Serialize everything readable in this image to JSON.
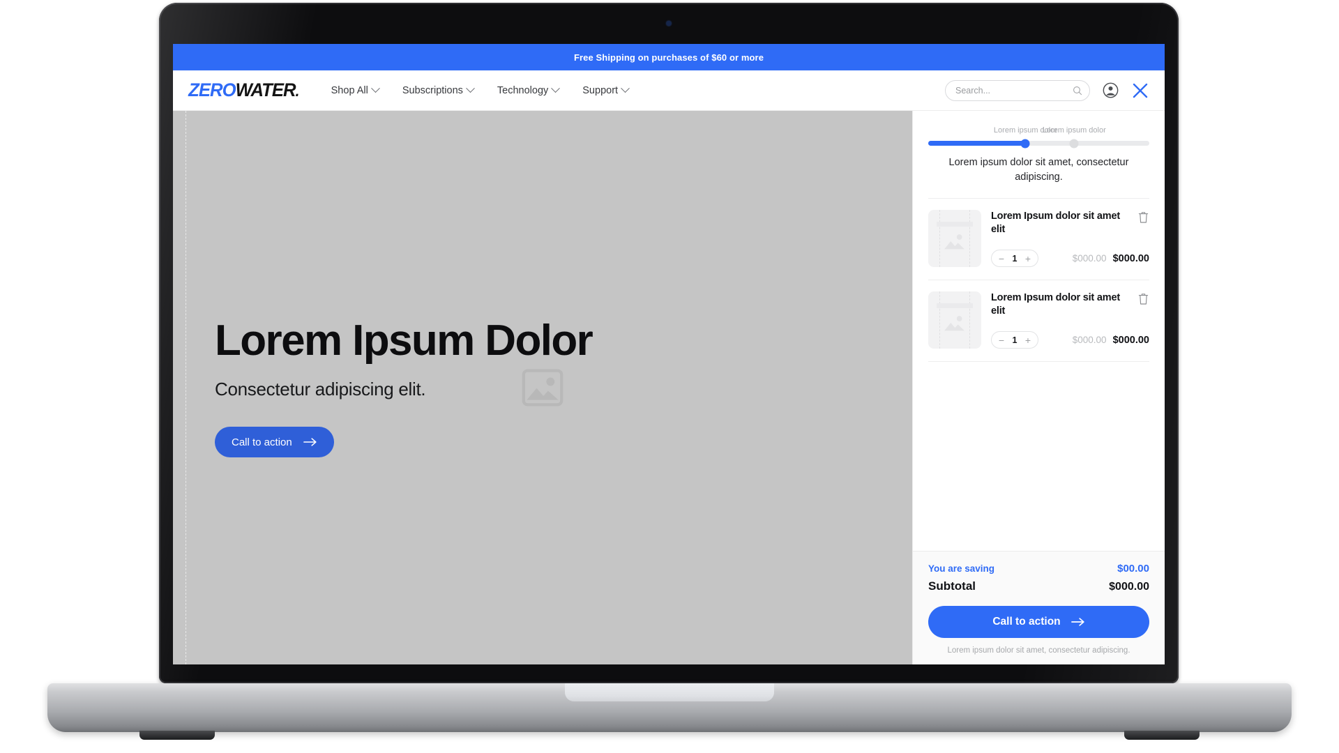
{
  "promo": {
    "text": "Free Shipping on purchases of $60 or more"
  },
  "header": {
    "logo_primary": "ZERO",
    "logo_secondary": "WATER",
    "logo_dot": ".",
    "nav": [
      {
        "label": "Shop All"
      },
      {
        "label": "Subscriptions"
      },
      {
        "label": "Technology"
      },
      {
        "label": "Support"
      }
    ],
    "search": {
      "placeholder": "Search...",
      "value": ""
    },
    "icons": {
      "search": "search-icon",
      "account": "account-icon",
      "close": "close-icon"
    }
  },
  "hero": {
    "heading": "Lorem Ipsum Dolor",
    "subheading": "Consectetur adipiscing elit.",
    "cta_label": "Call to action",
    "placeholder_icon": "image-placeholder-icon"
  },
  "cart": {
    "progress": {
      "fill_percent": 44,
      "milestones": [
        {
          "label": "Lorem ipsum dolor",
          "position_percent": 44,
          "reached": true
        },
        {
          "label": "Lorem ipsum dolor",
          "position_percent": 66,
          "reached": false
        }
      ],
      "note": "Lorem ipsum dolor sit amet, consectetur adipiscing."
    },
    "items": [
      {
        "title": "Lorem Ipsum dolor sit amet elit",
        "quantity": "1",
        "decrement_label": "−",
        "increment_label": "+",
        "price_old": "$000.00",
        "price_new": "$000.00",
        "remove_icon": "trash-icon"
      },
      {
        "title": "Lorem Ipsum dolor sit amet elit",
        "quantity": "1",
        "decrement_label": "−",
        "increment_label": "+",
        "price_old": "$000.00",
        "price_new": "$000.00",
        "remove_icon": "trash-icon"
      }
    ],
    "summary": {
      "saving_label": "You are saving",
      "saving_value": "$00.00",
      "subtotal_label": "Subtotal",
      "subtotal_value": "$000.00",
      "checkout_label": "Call to action",
      "fineprint": "Lorem ipsum dolor sit amet, consectetur adipiscing."
    }
  },
  "colors": {
    "accent_blue": "#2f6bf6",
    "hero_cta_blue": "#2f5fd8",
    "hero_bg": "#c5c5c5",
    "text_dark": "#111216",
    "muted": "#a9abaf"
  }
}
